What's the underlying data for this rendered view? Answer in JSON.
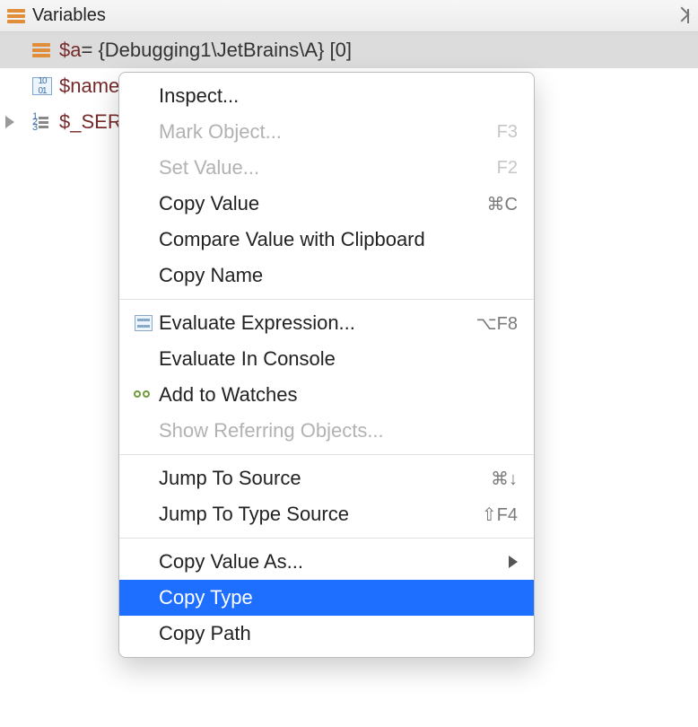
{
  "header": {
    "title": "Variables"
  },
  "variables": [
    {
      "name": "$a",
      "rest": " = {Debugging1\\JetBrains\\A} [0]",
      "icon": "bars",
      "selected": true,
      "disclosure": false
    },
    {
      "name": "$name",
      "rest": " = ",
      "icon": "bin",
      "selected": false,
      "disclosure": false
    },
    {
      "name": "$_SERVER",
      "rest": "",
      "icon": "struct",
      "selected": false,
      "disclosure": true
    }
  ],
  "menu": {
    "inspect": {
      "label": "Inspect..."
    },
    "markObject": {
      "label": "Mark Object...",
      "shortcut": "F3"
    },
    "setValue": {
      "label": "Set Value...",
      "shortcut": "F2"
    },
    "copyValue": {
      "label": "Copy Value",
      "shortcut": "⌘C"
    },
    "compareClip": {
      "label": "Compare Value with Clipboard"
    },
    "copyName": {
      "label": "Copy Name"
    },
    "evalExpr": {
      "label": "Evaluate Expression...",
      "shortcut": "⌥F8"
    },
    "evalConsole": {
      "label": "Evaluate In Console"
    },
    "addWatches": {
      "label": "Add to Watches"
    },
    "showRef": {
      "label": "Show Referring Objects..."
    },
    "jumpSource": {
      "label": "Jump To Source",
      "shortcut": "⌘↓"
    },
    "jumpTypeSource": {
      "label": "Jump To Type Source",
      "shortcut": "⇧F4"
    },
    "copyValueAs": {
      "label": "Copy Value As..."
    },
    "copyType": {
      "label": "Copy Type"
    },
    "copyPath": {
      "label": "Copy Path"
    }
  }
}
